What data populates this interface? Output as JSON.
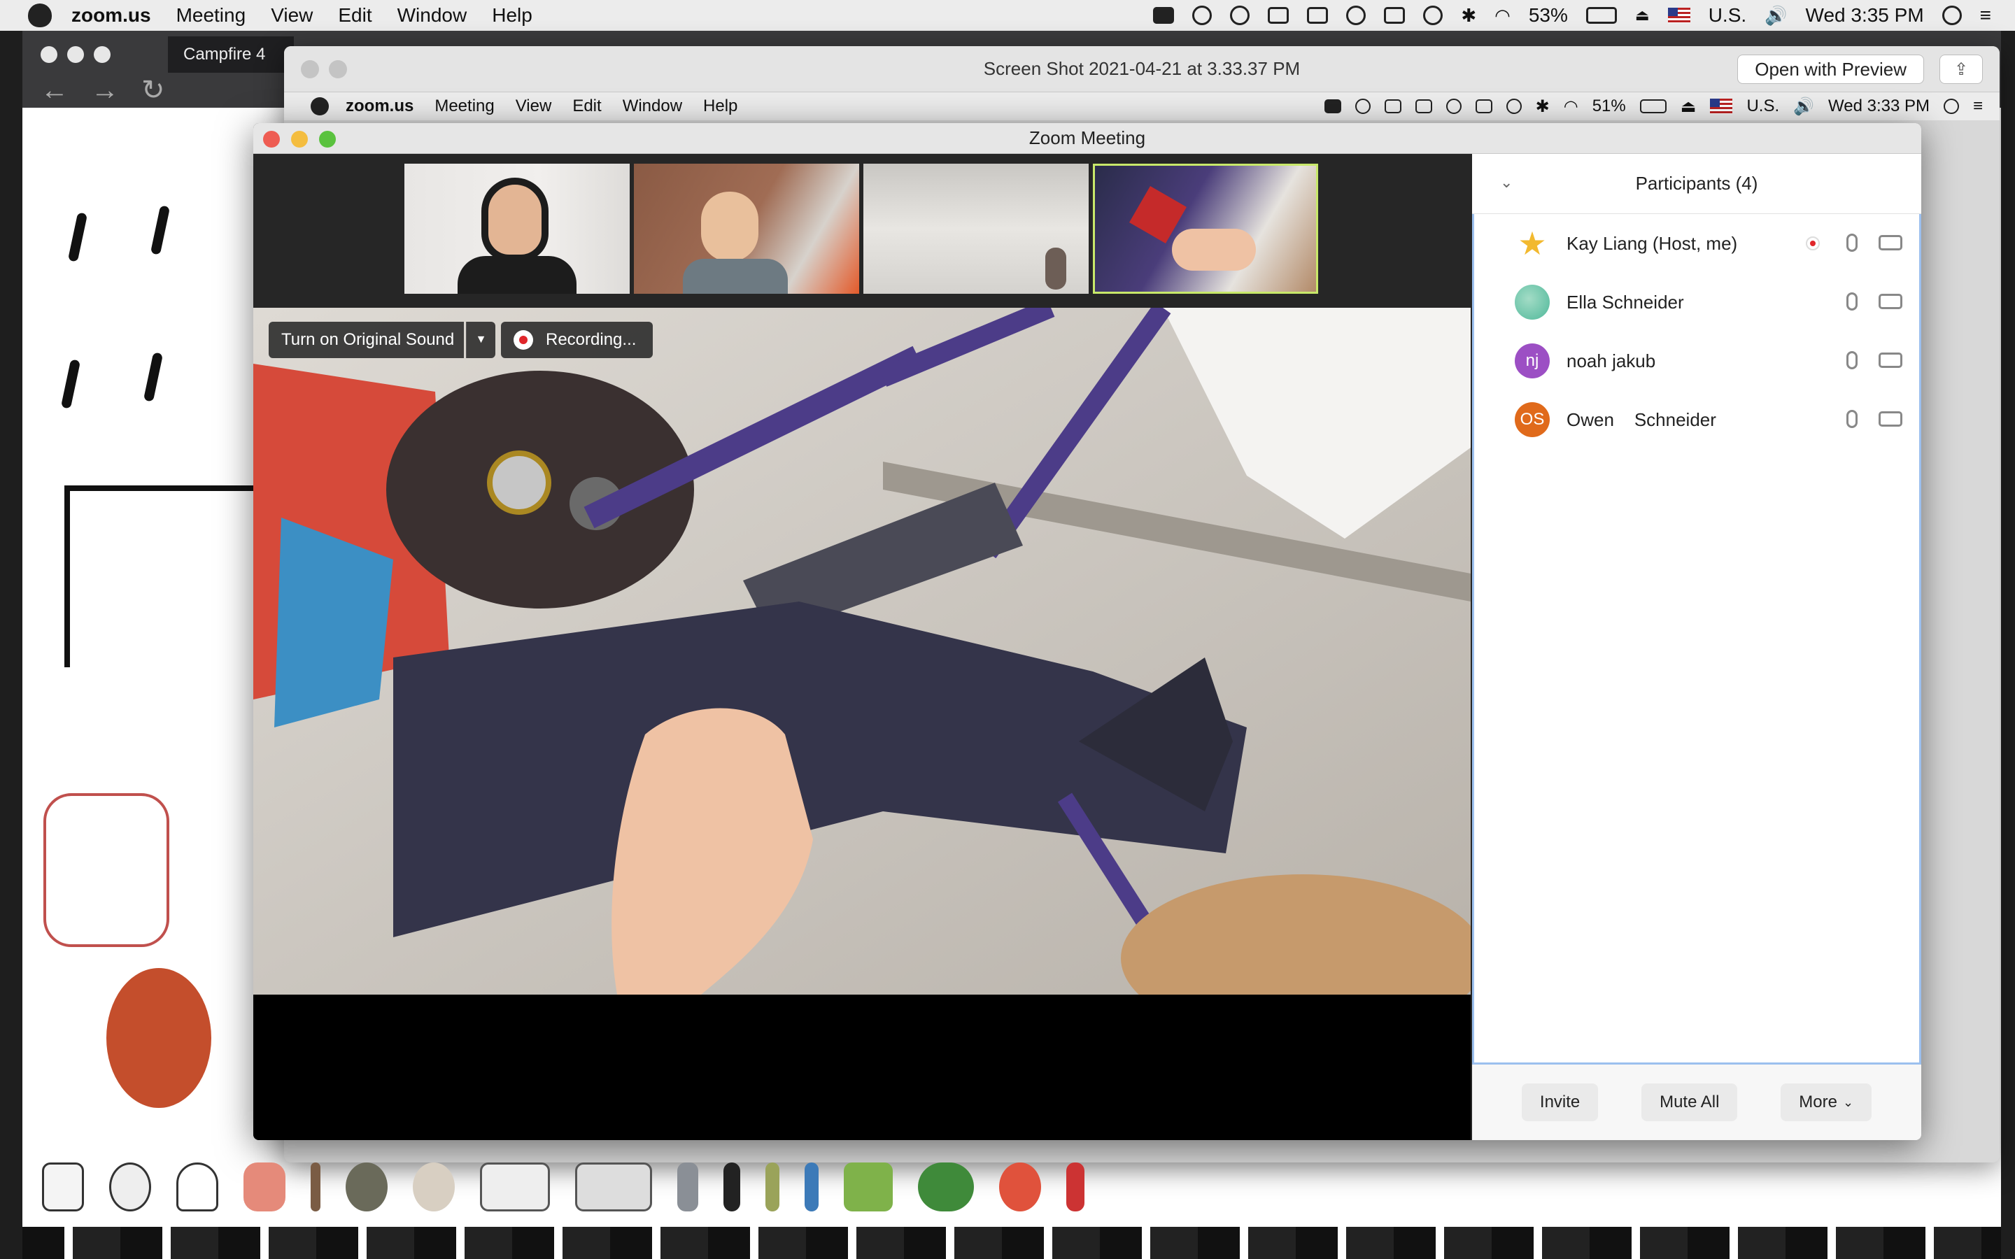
{
  "menubar": {
    "app": "zoom.us",
    "items": [
      "Meeting",
      "View",
      "Edit",
      "Window",
      "Help"
    ],
    "battery": "53%",
    "input_source": "U.S.",
    "clock": "Wed 3:35 PM"
  },
  "browser": {
    "tab_title": "Campfire 4"
  },
  "preview": {
    "title": "Screen Shot 2021-04-21 at 3.33.37 PM",
    "open_button": "Open with Preview"
  },
  "inner_menubar": {
    "app": "zoom.us",
    "items": [
      "Meeting",
      "View",
      "Edit",
      "Window",
      "Help"
    ],
    "battery": "51%",
    "input_source": "U.S.",
    "clock": "Wed 3:33 PM"
  },
  "zoom": {
    "title": "Zoom Meeting",
    "original_sound": "Turn on Original Sound",
    "recording": "Recording...",
    "participants_title": "Participants (4)",
    "participants": [
      {
        "name": "Kay Liang (Host, me)",
        "initials": "",
        "color": "#f2b92f"
      },
      {
        "name": "Ella Schneider",
        "initials": "",
        "color": "#4fb89a"
      },
      {
        "name": "noah jakub",
        "initials": "nj",
        "color": "#9c4fc4"
      },
      {
        "name": "Owen    Schneider",
        "initials": "OS",
        "color": "#e06a1b"
      }
    ],
    "buttons": {
      "invite": "Invite",
      "mute_all": "Mute All",
      "more": "More"
    }
  },
  "colors": {
    "record_red": "#e0262b",
    "panel_border": "#9cc0ee",
    "thumb_active": "#c8e86a"
  }
}
